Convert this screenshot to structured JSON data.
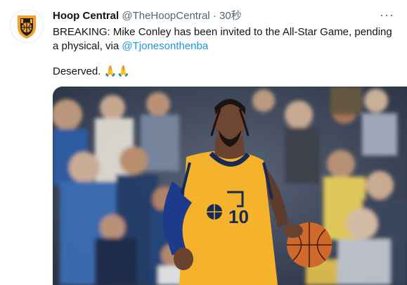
{
  "tweet": {
    "display_name": "Hoop Central",
    "handle": "@TheHoopCentral",
    "separator": "·",
    "timestamp": "30秒",
    "more_label": "···",
    "body_text": "BREAKING: Mike Conley has been invited to the All-Star Game, pending a physical, via ",
    "mention": "@Tjonesonthenba",
    "second_line": "Deserved. ",
    "emoji": "🙏🙏",
    "jersey_number": "10"
  },
  "colors": {
    "link": "#1b95e0",
    "secondary_text": "#536471",
    "jersey_yellow": "#f5b22d",
    "jersey_navy": "#162a53"
  },
  "icons": {
    "avatar": "hoop-central-logo-icon",
    "more": "ellipsis-icon"
  }
}
